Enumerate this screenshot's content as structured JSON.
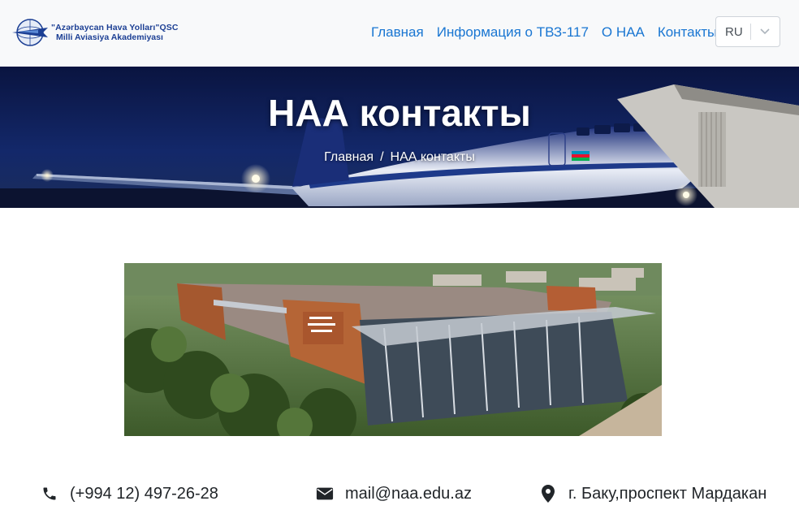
{
  "header": {
    "logo": {
      "line1": "\"Azərbaycan Hava Yolları\"QSC",
      "line2": "Milli Aviasiya Akademiyası"
    },
    "nav": [
      {
        "label": "Главная"
      },
      {
        "label": "Информация о ТВЗ-117"
      },
      {
        "label": "О НАА"
      },
      {
        "label": "Контакты"
      }
    ],
    "language": {
      "selected": "RU"
    }
  },
  "hero": {
    "title": "НАА контакты",
    "breadcrumb": {
      "home": "Главная",
      "separator": "/",
      "current": "НАА контакты"
    }
  },
  "contacts": {
    "phone": {
      "icon": "phone-icon",
      "text": "(+994 12) 497-26-28"
    },
    "email": {
      "icon": "envelope-icon",
      "text": "mail@naa.edu.az"
    },
    "address": {
      "icon": "map-marker-icon",
      "text": "г. Баку,проспект Мардакан"
    }
  },
  "colors": {
    "nav_link": "#1976d2",
    "logo_blue": "#1c3f94",
    "header_bg": "#f8f9fa",
    "hero_bg": "#0b1a4e"
  }
}
